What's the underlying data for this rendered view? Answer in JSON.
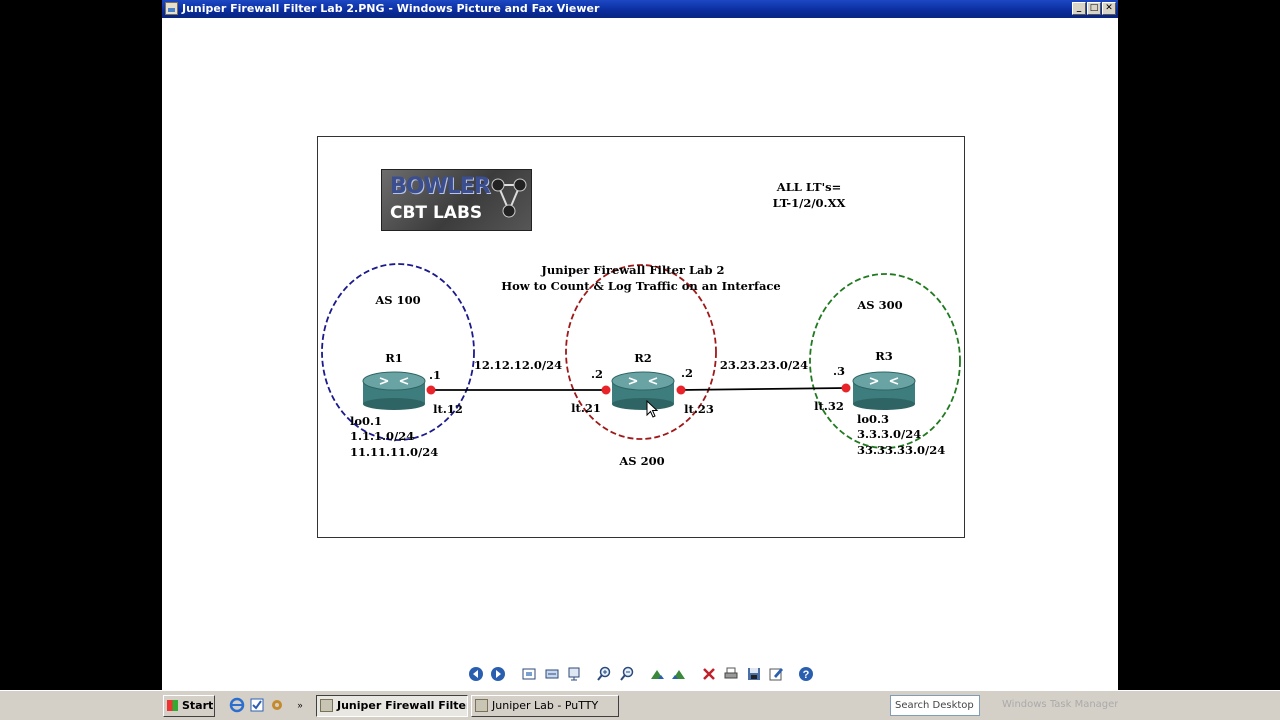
{
  "window": {
    "title": "Juniper Firewall Filter Lab 2.PNG - Windows Picture and Fax Viewer",
    "buttons": {
      "minimize": "_",
      "maximize": "□",
      "close": "✕"
    }
  },
  "diagram": {
    "logo": {
      "line1": "BOWLER",
      "line2": "CBT LABS"
    },
    "note": {
      "line1": "ALL LT's=",
      "line2": "LT-1/2/0.XX"
    },
    "title": {
      "line1": "Juniper Firewall Filter Lab 2",
      "line2": "How to Count & Log Traffic on an Interface"
    },
    "as_labels": {
      "as100": "AS 100",
      "as200": "AS 200",
      "as300": "AS 300"
    },
    "routers": [
      {
        "name": "R1",
        "loopback": [
          "lo0.1",
          "1.1.1.0/24",
          "11.11.11.0/24"
        ]
      },
      {
        "name": "R2",
        "loopback": []
      },
      {
        "name": "R3",
        "loopback": [
          "lo0.3",
          "3.3.3.0/24",
          "33.33.33.0/24"
        ]
      }
    ],
    "links": [
      {
        "subnet": "12.12.12.0/24",
        "left_host": ".1",
        "left_if": "lt.12",
        "right_host": ".2",
        "right_if": "lt.21"
      },
      {
        "subnet": "23.23.23.0/24",
        "left_host": ".2",
        "left_if": "lt.23",
        "right_host": ".3",
        "right_if": "lt.32"
      }
    ],
    "colors": {
      "as100": "#1a1a8c",
      "as200": "#a01818",
      "as300": "#1f7a1f",
      "port": "#e8232a",
      "router": "#3d7d7d"
    }
  },
  "toolbar": {
    "buttons": [
      "previous-image",
      "next-image",
      "best-fit",
      "actual-size",
      "slideshow",
      "zoom-in",
      "zoom-out",
      "rotate-clockwise",
      "rotate-counterclockwise",
      "delete",
      "print",
      "copy-to",
      "open-for-editing",
      "help"
    ]
  },
  "taskbar": {
    "start_label": "Start",
    "tasks": [
      {
        "label": "Juniper Firewall Filter ...",
        "active": true
      },
      {
        "label": "Juniper Lab - PuTTY",
        "active": false
      }
    ],
    "search_placeholder": "Search Desktop",
    "tray_text": "Windows Task Manager"
  }
}
